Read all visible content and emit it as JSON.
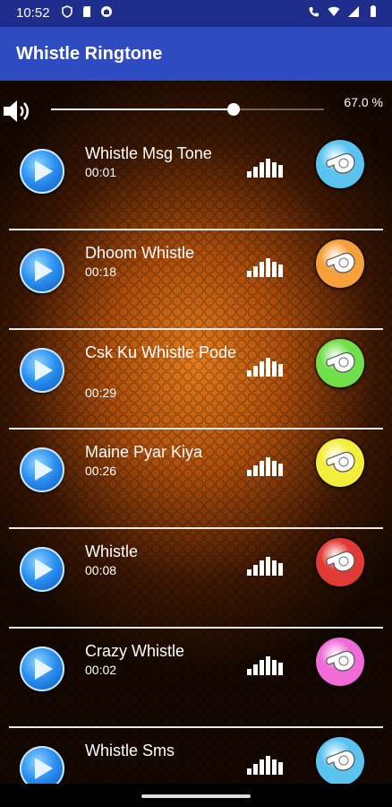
{
  "status": {
    "time": "10:52"
  },
  "app": {
    "title": "Whistle Ringtone"
  },
  "volume": {
    "percent_label": "67.0 %",
    "level": 0.67
  },
  "tracks": [
    {
      "title": "Whistle Msg Tone",
      "duration": "00:01",
      "whistle_color": "#5bc3ef"
    },
    {
      "title": "Dhoom Whistle",
      "duration": "00:18",
      "whistle_color": "#f5a03a"
    },
    {
      "title": "Csk Ku Whistle Pode",
      "duration": "00:29",
      "whistle_color": "#6fe04a"
    },
    {
      "title": "Maine Pyar Kiya",
      "duration": "00:26",
      "whistle_color": "#f2ef3a"
    },
    {
      "title": "Whistle",
      "duration": "00:08",
      "whistle_color": "#e23a34"
    },
    {
      "title": "Crazy Whistle",
      "duration": "00:02",
      "whistle_color": "#f06bd8"
    },
    {
      "title": "Whistle Sms",
      "duration": "",
      "whistle_color": "#5bc3ef"
    }
  ],
  "icons": {
    "play": "play-icon",
    "bars": "equalizer-bars-icon",
    "whistle": "whistle-icon",
    "speaker": "speaker-icon"
  }
}
